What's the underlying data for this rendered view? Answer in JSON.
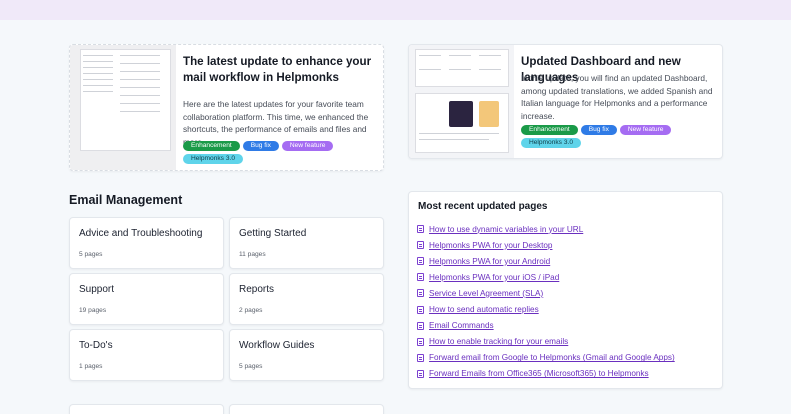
{
  "news": [
    {
      "title": "The latest update to enhance your mail workflow in Helpmonks",
      "description": "Here are the latest updates for your favorite team collaboration platform. This time, we enhanced the shortcuts, the performance of emails and files and more.",
      "tags": [
        {
          "label": "Enhancement",
          "color": "#1a9a48"
        },
        {
          "label": "Bug fix",
          "color": "#2f7be6"
        },
        {
          "label": "New feature",
          "color": "#a56cf2"
        },
        {
          "label": "Helpmonks 3.0",
          "color": "#5fd4ea"
        }
      ]
    },
    {
      "title": "Updated Dashboard and new languages",
      "description": "In this update, you will find an updated Dashboard, among updated translations, we added Spanish and Italian language for Helpmonks and a performance increase.",
      "tags": [
        {
          "label": "Enhancement",
          "color": "#1a9a48"
        },
        {
          "label": "Bug fix",
          "color": "#2f7be6"
        },
        {
          "label": "New feature",
          "color": "#a56cf2"
        },
        {
          "label": "Helpmonks 3.0",
          "color": "#5fd4ea"
        }
      ]
    }
  ],
  "section": {
    "title": "Email Management"
  },
  "topics": [
    {
      "name": "Advice and Troubleshooting",
      "count": "5 pages"
    },
    {
      "name": "Getting Started",
      "count": "11 pages"
    },
    {
      "name": "Support",
      "count": "19 pages"
    },
    {
      "name": "Reports",
      "count": "2 pages"
    },
    {
      "name": "To-Do's",
      "count": "1 pages"
    },
    {
      "name": "Workflow Guides",
      "count": "5 pages"
    }
  ],
  "recent": {
    "title": "Most recent updated pages",
    "items": [
      "How to use dynamic variables in your URL",
      "Helpmonks PWA for your Desktop",
      "Helpmonks PWA for your Android",
      "Helpmonks PWA for your iOS / iPad",
      "Service Level Agreement (SLA)",
      "How to send automatic replies",
      "Email Commands",
      "How to enable tracking for your emails",
      "Forward email from Google to Helpmonks (Gmail and Google Apps)",
      "Forward Emails from Office365 (Microsoft365) to Helpmonks"
    ]
  }
}
